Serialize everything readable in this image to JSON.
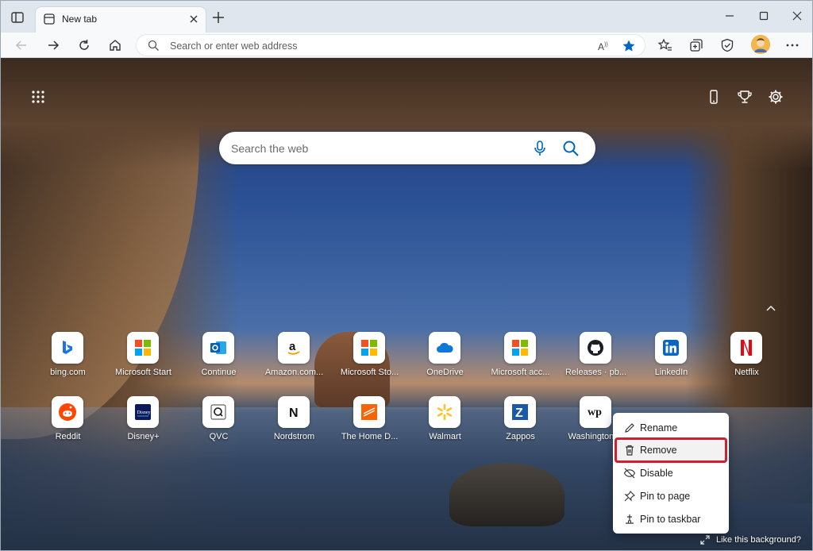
{
  "browser": {
    "tab": {
      "title": "New tab"
    },
    "address_bar": {
      "placeholder": "Search or enter web address"
    }
  },
  "page": {
    "search": {
      "placeholder": "Search the web"
    },
    "quick_links_row1": [
      {
        "label": "bing.com",
        "icon": "bing-icon"
      },
      {
        "label": "Microsoft Start",
        "icon": "microsoft-logo-icon"
      },
      {
        "label": "Continue",
        "icon": "outlook-icon"
      },
      {
        "label": "Amazon.com...",
        "icon": "amazon-icon"
      },
      {
        "label": "Microsoft Sto...",
        "icon": "microsoft-logo-icon"
      },
      {
        "label": "OneDrive",
        "icon": "onedrive-icon"
      },
      {
        "label": "Microsoft acc...",
        "icon": "microsoft-logo-icon"
      },
      {
        "label": "Releases · pb...",
        "icon": "github-icon"
      },
      {
        "label": "LinkedIn",
        "icon": "linkedin-icon"
      },
      {
        "label": "Netflix",
        "icon": "netflix-icon"
      }
    ],
    "quick_links_row2": [
      {
        "label": "Reddit",
        "icon": "reddit-icon"
      },
      {
        "label": "Disney+",
        "icon": "disney-plus-icon"
      },
      {
        "label": "QVC",
        "icon": "qvc-icon"
      },
      {
        "label": "Nordstrom",
        "icon": "nordstrom-icon"
      },
      {
        "label": "The Home D...",
        "icon": "home-depot-icon"
      },
      {
        "label": "Walmart",
        "icon": "walmart-icon"
      },
      {
        "label": "Zappos",
        "icon": "zappos-icon"
      },
      {
        "label": "Washington ...",
        "icon": "washington-post-icon"
      }
    ],
    "context_menu": {
      "items": [
        {
          "label": "Rename",
          "icon": "pencil-icon"
        },
        {
          "label": "Remove",
          "icon": "trash-icon"
        },
        {
          "label": "Disable",
          "icon": "eye-off-icon"
        },
        {
          "label": "Pin to page",
          "icon": "pin-icon"
        },
        {
          "label": "Pin to taskbar",
          "icon": "taskbar-pin-icon"
        }
      ],
      "highlighted": "Remove",
      "highlight_color": "#d11f2f"
    },
    "background_prompt": "Like this background?"
  },
  "colors": {
    "accent": "#0067c0",
    "favorite_star": "#0067c0"
  }
}
